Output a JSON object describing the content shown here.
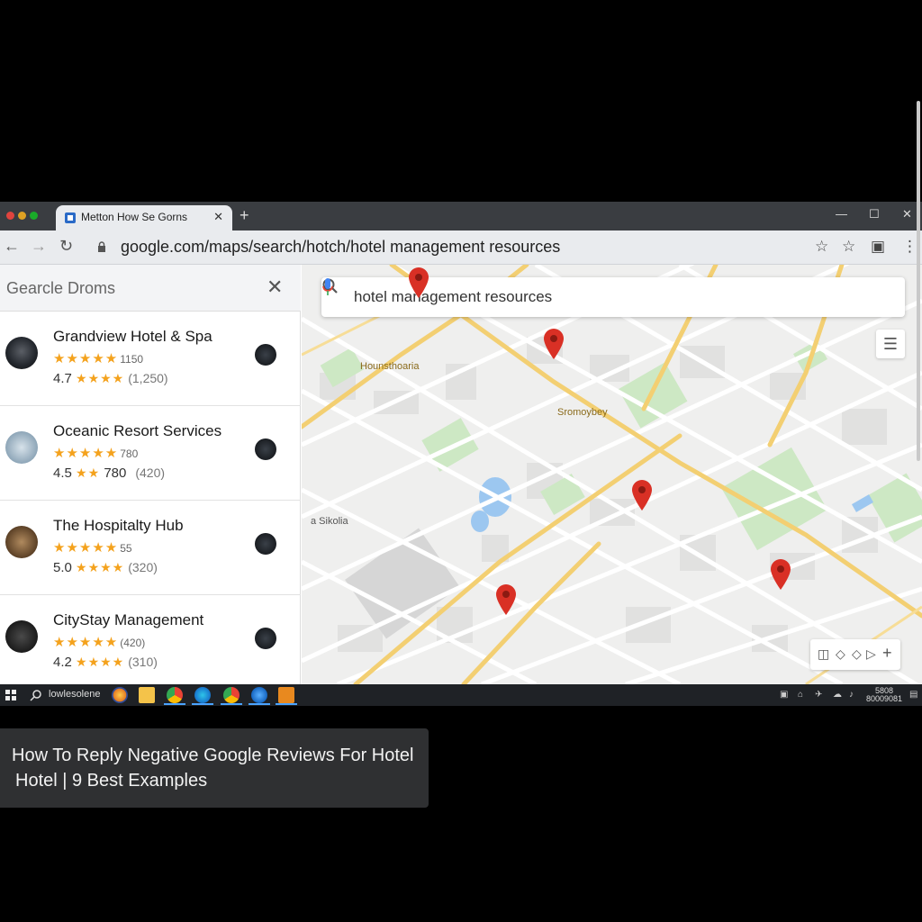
{
  "browser": {
    "tab_title": "Metton How Se Gorns",
    "url": "google.com/maps/search/hotch/hotel management resources",
    "nav_icons": [
      "back-arrow-icon",
      "forward-arrow-icon",
      "reload-icon"
    ],
    "toolbar_icons": [
      "bookmark-star-icon",
      "star-icon",
      "extension-icon",
      "menu-icon"
    ]
  },
  "panel": {
    "title": "Gearcle Droms",
    "results": [
      {
        "name": "Grandview Hotel & Spa",
        "stars_small": "1150",
        "rating": "4.7",
        "count": "(1,250)",
        "inline_value": ""
      },
      {
        "name": "Oceanic Resort Services",
        "stars_small": "780",
        "rating": "4.5",
        "count": "(420)",
        "inline_value": "780"
      },
      {
        "name": "The Hospitalty Hub",
        "stars_small": "55",
        "rating": "5.0",
        "count": "(320)",
        "inline_value": ""
      },
      {
        "name": "CityStay Management",
        "stars_small": "(420)",
        "rating": "4.2",
        "count": "(310)",
        "inline_value": ""
      }
    ]
  },
  "map": {
    "search_value": "hotel management resources",
    "labels": [
      "Hounsthoaria",
      "Sromoybey",
      "a Sikolia"
    ],
    "pin_color": "#d93025"
  },
  "taskbar": {
    "search_text": "lowlesolene",
    "tray_time_1": "5808",
    "tray_time_2": "80009081"
  },
  "caption": {
    "line1": "How To Reply Negative Google Reviews For Hotel",
    "line2": "Hotel | 9 Best Examples"
  },
  "colors": {
    "star": "#f4a21d",
    "road_major": "#f3cf72",
    "park": "#cde8c4",
    "water": "#9cc7f0"
  }
}
